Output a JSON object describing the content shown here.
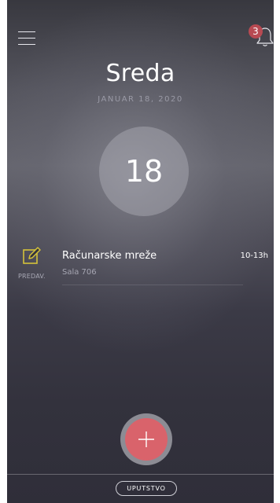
{
  "header": {
    "menu_icon": "hamburger-menu-icon",
    "bell_icon": "bell-icon",
    "notification_count": "3"
  },
  "day": {
    "weekday": "Sreda",
    "date": "JANUAR 18, 2020",
    "day_number": "18"
  },
  "events": [
    {
      "icon": "edit-note-icon",
      "type": "PREDAV.",
      "name": "Računarske mreže",
      "room": "Sala 706",
      "time": "10-13h"
    }
  ],
  "fab": {
    "icon": "plus-icon"
  },
  "footer": {
    "help_label": "UPUTSTVO"
  },
  "colors": {
    "accent_fab": "#d9636b",
    "badge": "#b84a52",
    "event_icon": "#d4c23a"
  }
}
